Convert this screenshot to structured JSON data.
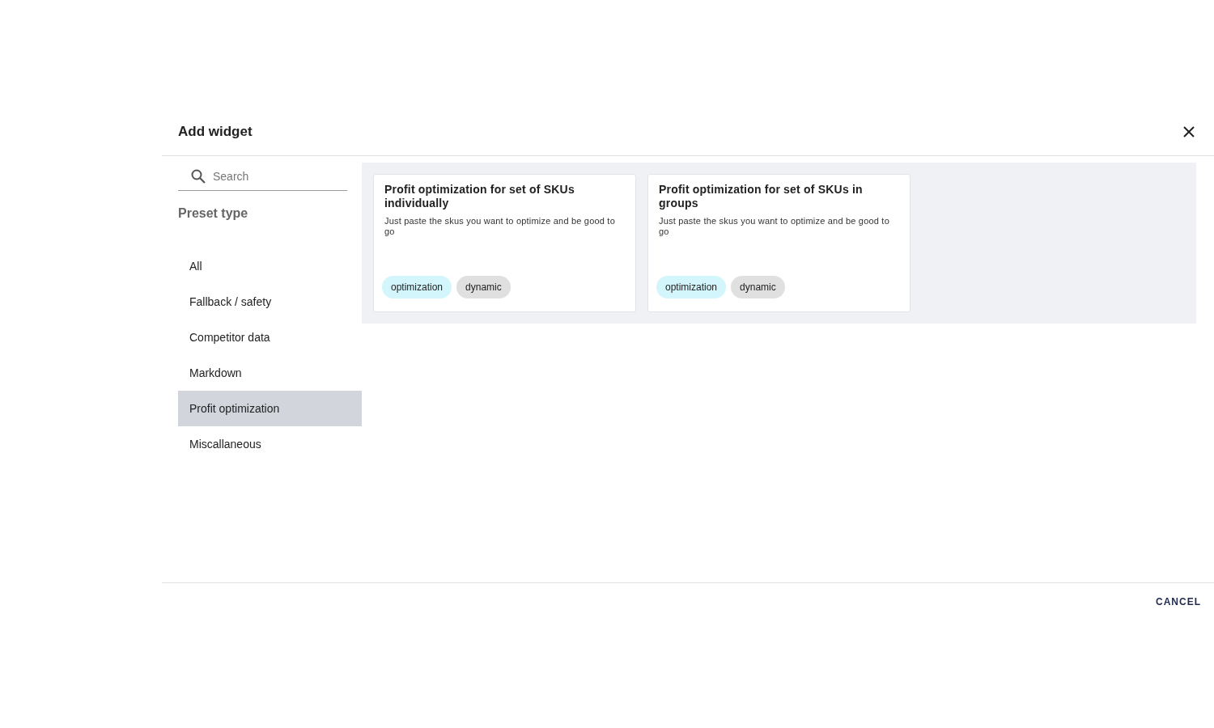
{
  "dialog": {
    "title": "Add widget"
  },
  "search": {
    "placeholder": "Search"
  },
  "sidebar": {
    "heading": "Preset type",
    "items": [
      {
        "label": "All",
        "selected": false
      },
      {
        "label": "Fallback / safety",
        "selected": false
      },
      {
        "label": "Competitor data",
        "selected": false
      },
      {
        "label": "Markdown",
        "selected": false
      },
      {
        "label": "Profit optimization",
        "selected": true
      },
      {
        "label": "Miscallaneous",
        "selected": false
      }
    ]
  },
  "cards": [
    {
      "title": "Profit optimization for set of SKUs individually",
      "description": "Just paste the skus you want to optimize and be good to go",
      "tags": [
        {
          "label": "optimization",
          "color": "#d3f6fd"
        },
        {
          "label": "dynamic",
          "color": "#e0e0e0"
        }
      ]
    },
    {
      "title": "Profit optimization for set of SKUs in groups",
      "description": "Just paste the skus you want to optimize and be good to go",
      "tags": [
        {
          "label": "optimization",
          "color": "#d3f6fd"
        },
        {
          "label": "dynamic",
          "color": "#e0e0e0"
        }
      ]
    }
  ],
  "buttons": [
    "CANCEL"
  ]
}
